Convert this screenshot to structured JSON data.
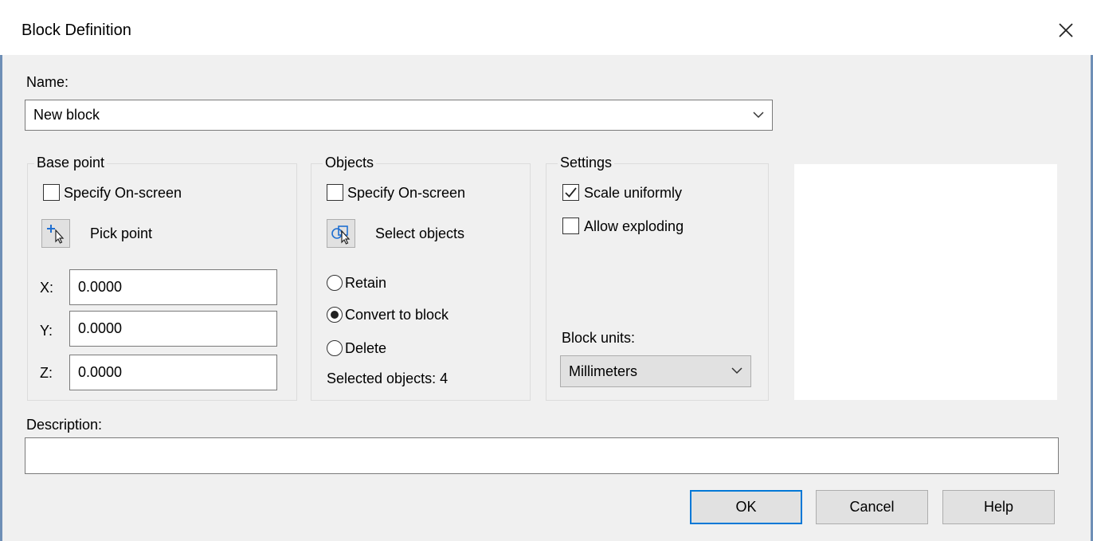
{
  "window": {
    "title": "Block Definition"
  },
  "name": {
    "label": "Name:",
    "value": "New block"
  },
  "base_point": {
    "title": "Base point",
    "specify_onscreen": {
      "label": "Specify On-screen",
      "checked": false
    },
    "pick_point_label": "Pick point",
    "x_label": "X:",
    "x_value": "0.0000",
    "y_label": "Y:",
    "y_value": "0.0000",
    "z_label": "Z:",
    "z_value": "0.0000"
  },
  "objects": {
    "title": "Objects",
    "specify_onscreen": {
      "label": "Specify On-screen",
      "checked": false
    },
    "select_objects_label": "Select objects",
    "retain_label": "Retain",
    "convert_label": "Convert to block",
    "delete_label": "Delete",
    "selected_option": "Convert to block",
    "selected_count_text": "Selected objects: 4"
  },
  "settings": {
    "title": "Settings",
    "scale_uniformly": {
      "label": "Scale uniformly",
      "checked": true
    },
    "allow_exploding": {
      "label": "Allow exploding",
      "checked": false
    },
    "block_units_label": "Block units:",
    "block_units_value": "Millimeters"
  },
  "description": {
    "label": "Description:",
    "value": ""
  },
  "buttons": {
    "ok": "OK",
    "cancel": "Cancel",
    "help": "Help"
  },
  "icons": {
    "close": "close-icon",
    "dropdown": "chevron-down-icon",
    "pick_point": "pick-point-icon",
    "select_objects": "select-objects-icon",
    "check": "checkmark-icon"
  },
  "colors": {
    "accent": "#0078d7",
    "dialog_bg": "#f0f0f0"
  }
}
